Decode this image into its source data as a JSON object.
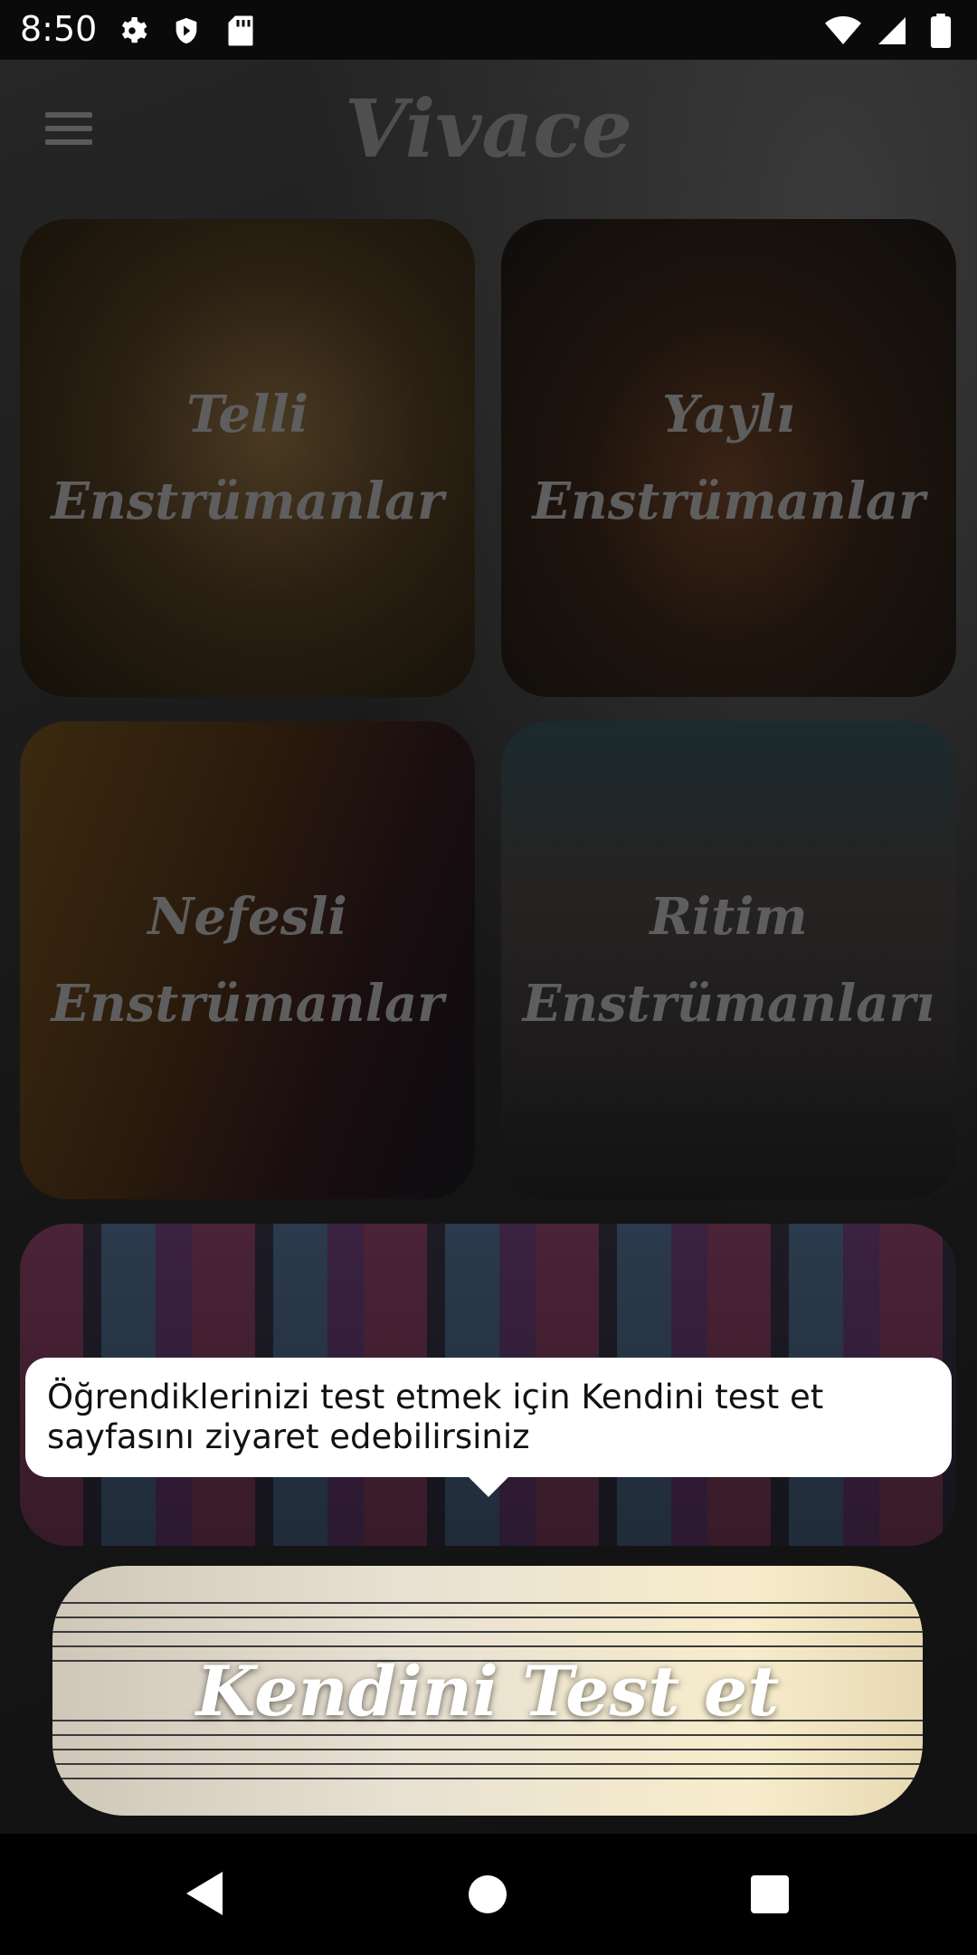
{
  "status_bar": {
    "time": "8:50",
    "left_icons": [
      "gear-icon",
      "shield-icon",
      "sd-card-icon"
    ],
    "right_icons": [
      "wifi-icon",
      "signal-icon",
      "battery-icon"
    ]
  },
  "header": {
    "title": "Vivace",
    "menu_icon": "hamburger-menu-icon"
  },
  "categories": [
    {
      "label": "Telli Enstrümanlar"
    },
    {
      "label": "Yaylı Enstrümanlar"
    },
    {
      "label": "Nefesli Enstrümanlar"
    },
    {
      "label": "Ritim Enstrümanları"
    }
  ],
  "piano_card": {
    "label": ""
  },
  "test_card": {
    "label": "Kendini Test et"
  },
  "tooltip": {
    "text": "Öğrendiklerinizi test etmek için Kendini test et sayfasını ziyaret edebilirsiniz"
  },
  "nav": {
    "back_icon": "back-triangle-icon",
    "home_icon": "home-circle-icon",
    "recents_icon": "recents-square-icon"
  }
}
